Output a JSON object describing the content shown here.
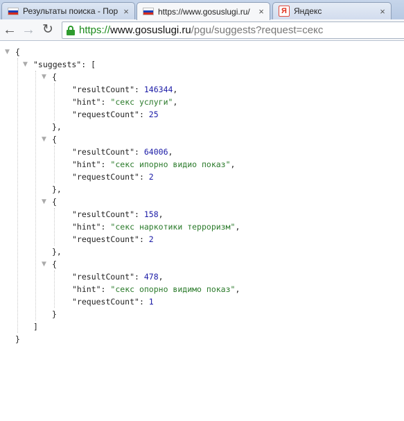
{
  "tabs": [
    {
      "title": "Результаты поиска - Пор",
      "favicon": "russian-flag-icon"
    },
    {
      "title": "https://www.gosuslugi.ru/",
      "favicon": "russian-flag-icon",
      "active": true
    },
    {
      "title": "Яндекс",
      "favicon": "yandex-icon"
    }
  ],
  "close_glyph": "×",
  "yandex_letter": "Я",
  "address_bar": {
    "scheme": "https://",
    "host": "www.gosuslugi.ru",
    "path": "/pgu/suggests?request=секс"
  },
  "json": {
    "root_key": "suggests",
    "keys": {
      "result_count": "resultCount",
      "hint": "hint",
      "request_count": "requestCount"
    },
    "suggests": [
      {
        "resultCount": "146344",
        "hint": "секс услуги",
        "requestCount": "25"
      },
      {
        "resultCount": "64006",
        "hint": "секс ипорно видио показ",
        "requestCount": "2"
      },
      {
        "resultCount": "158",
        "hint": "секс наркотики терроризм",
        "requestCount": "2"
      },
      {
        "resultCount": "478",
        "hint": "секс опорно видимо показ",
        "requestCount": "1"
      }
    ]
  },
  "colors": {
    "number": "#1a1aa6",
    "string": "#2a7a2a",
    "secure": "#1b8a1b"
  }
}
